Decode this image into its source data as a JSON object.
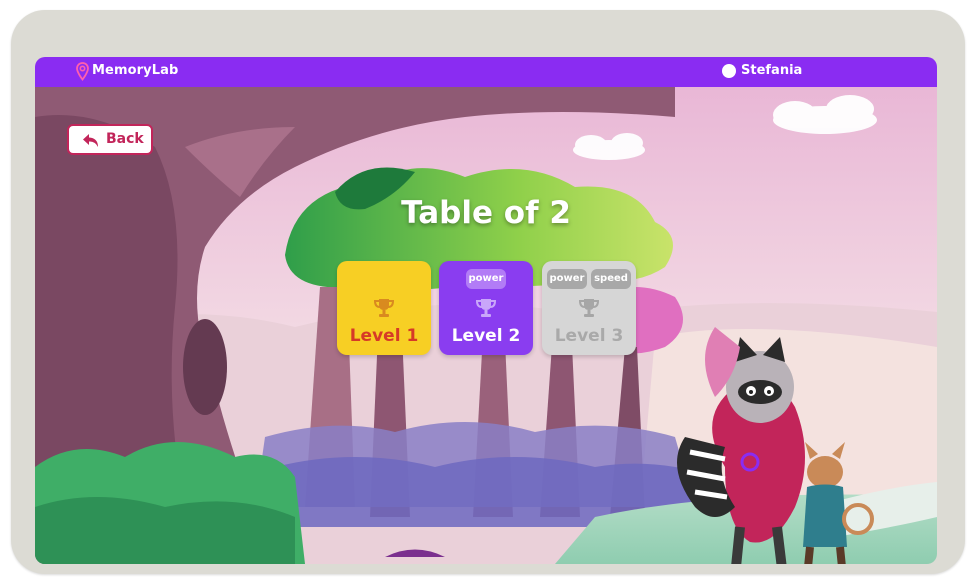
{
  "app": {
    "name": "MemoryLab"
  },
  "user": {
    "name": "Stefania"
  },
  "nav": {
    "back_label": "Back"
  },
  "page": {
    "title": "Table of 2"
  },
  "levels": [
    {
      "label": "Level 1",
      "tags": [],
      "state": "unlocked",
      "color": "#f7cf24"
    },
    {
      "label": "Level 2",
      "tags": [
        "power"
      ],
      "state": "unlocked",
      "color": "#8a3df0"
    },
    {
      "label": "Level 3",
      "tags": [
        "power",
        "speed"
      ],
      "state": "locked",
      "color": "#d6d6d6"
    }
  ],
  "colors": {
    "header": "#8a2cf2",
    "accent": "#c2255a"
  },
  "icons": {
    "brand": "location-pin-icon",
    "back": "undo-arrow-icon",
    "level": "trophy-icon",
    "user": "avatar"
  }
}
